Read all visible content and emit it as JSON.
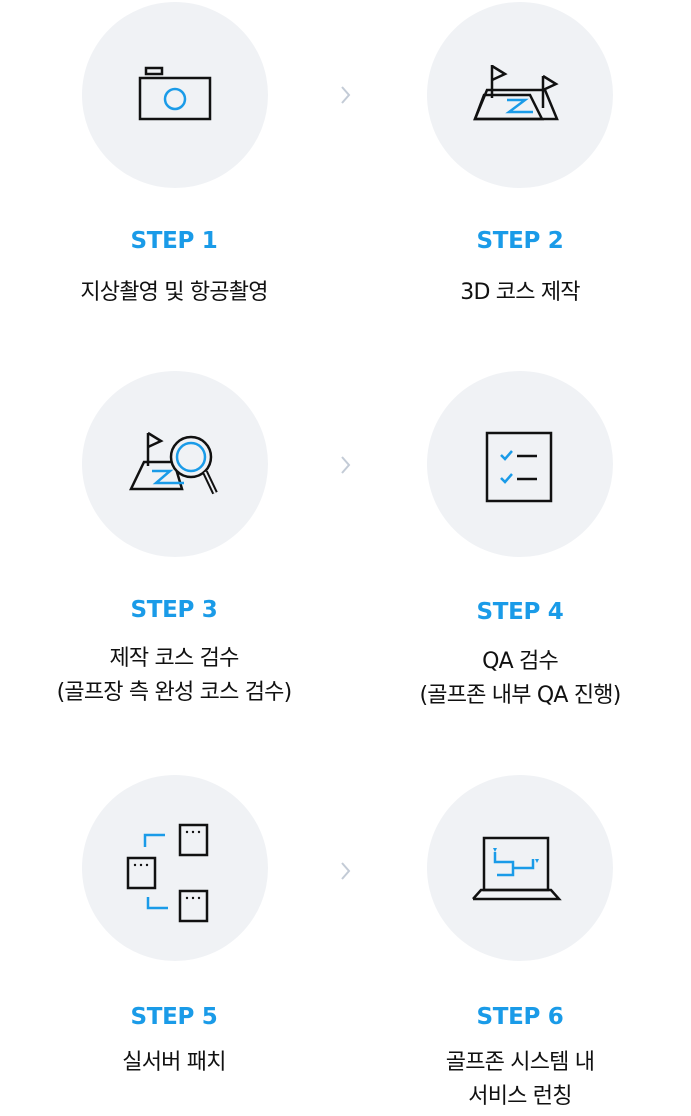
{
  "steps": [
    {
      "label": "STEP 1",
      "lines": [
        "지상촬영 및 항공촬영"
      ],
      "icon": "camera-icon"
    },
    {
      "label": "STEP 2",
      "lines": [
        "3D 코스 제작"
      ],
      "icon": "course-map-flags-icon"
    },
    {
      "label": "STEP 3",
      "lines": [
        "제작 코스 검수",
        "(골프장 측 완성 코스 검수)"
      ],
      "icon": "course-inspect-magnifier-icon"
    },
    {
      "label": "STEP 4",
      "lines": [
        "QA 검수",
        "(골프존 내부 QA 진행)"
      ],
      "icon": "checklist-icon"
    },
    {
      "label": "STEP 5",
      "lines": [
        "실서버 패치"
      ],
      "icon": "server-deploy-icon"
    },
    {
      "label": "STEP 6",
      "lines": [
        "골프존 시스템 내",
        "서비스 런칭"
      ],
      "icon": "laptop-course-icon"
    }
  ],
  "colors": {
    "accent": "#1a9be8",
    "circle": "#f0f2f5",
    "icon_stroke": "#111111",
    "arrow": "#c3cbd6"
  }
}
